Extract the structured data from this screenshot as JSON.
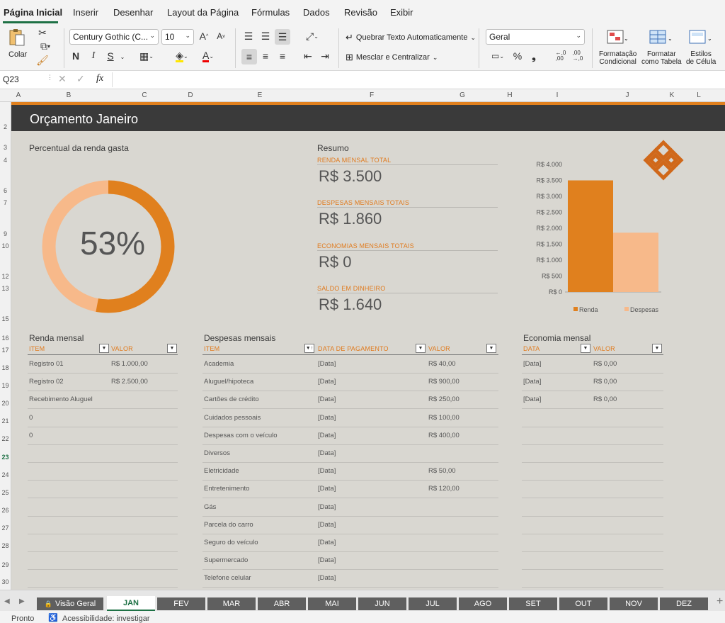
{
  "ribbon_tabs": [
    "Página Inicial",
    "Inserir",
    "Desenhar",
    "Layout da Página",
    "Fórmulas",
    "Dados",
    "Revisão",
    "Exibir"
  ],
  "ribbon": {
    "paste_label": "Colar",
    "font_name": "Century Gothic (C...",
    "font_size": "10",
    "bold": "N",
    "italic": "I",
    "underline": "S",
    "wrap_text": "Quebrar Texto Automaticamente",
    "merge_center": "Mesclar e Centralizar",
    "number_format": "Geral",
    "percent": "%",
    "comma": "❟",
    "dec_inc": "←,0\n,00",
    "dec_dec": ",00\n→,0",
    "cond_format": [
      "Formatação",
      "Condicional"
    ],
    "format_table": [
      "Formatar",
      "como Tabela"
    ],
    "cell_styles": [
      "Estilos",
      "de Célula"
    ]
  },
  "formula_bar": {
    "name_box": "Q23",
    "fx": "fx",
    "value": ""
  },
  "columns": [
    [
      "A",
      26
    ],
    [
      "B",
      97
    ],
    [
      "C",
      204
    ],
    [
      "D",
      269
    ],
    [
      "E",
      367
    ],
    [
      "F",
      525
    ],
    [
      "G",
      653
    ],
    [
      "H",
      720
    ],
    [
      "I",
      787
    ],
    [
      "J",
      886
    ],
    [
      "K",
      949
    ],
    [
      "L",
      987
    ]
  ],
  "rows": [
    [
      "2",
      179
    ],
    [
      "3",
      208
    ],
    [
      "4",
      226
    ],
    [
      "6",
      269
    ],
    [
      "7",
      286
    ],
    [
      "9",
      330
    ],
    [
      "10",
      347
    ],
    [
      "12",
      390
    ],
    [
      "13",
      407
    ],
    [
      "15",
      450
    ],
    [
      "16",
      477
    ],
    [
      "17",
      494
    ],
    [
      "18",
      519
    ],
    [
      "19",
      544
    ],
    [
      "20",
      569
    ],
    [
      "21",
      594
    ],
    [
      "22",
      619
    ],
    [
      "23",
      645
    ],
    [
      "24",
      670
    ],
    [
      "25",
      695
    ],
    [
      "26",
      720
    ],
    [
      "27",
      745
    ],
    [
      "28",
      770
    ],
    [
      "29",
      797
    ],
    [
      "30",
      821
    ]
  ],
  "selected_row": "23",
  "sheet": {
    "title": "Orçamento Janeiro",
    "pct_label": "Percentual da renda gasta",
    "pct_value": "53%",
    "pct_fraction": 0.53,
    "colors": {
      "accent": "#e0801e",
      "light": "#f7b98a",
      "dark": "#3a3a3a"
    },
    "summary": {
      "label": "Resumo",
      "items": [
        {
          "label": "RENDA MENSAL TOTAL",
          "value": "R$ 3.500"
        },
        {
          "label": "DESPESAS MENSAIS TOTAIS",
          "value": "R$ 1.860"
        },
        {
          "label": "ECONOMIAS MENSAIS TOTAIS",
          "value": "R$ 0"
        },
        {
          "label": "SALDO EM DINHEIRO",
          "value": "R$ 1.640"
        }
      ]
    },
    "income": {
      "label": "Renda mensal",
      "headers": [
        "ITEM",
        "VALOR"
      ],
      "rows": [
        [
          "Registro 01",
          "R$ 1.000,00"
        ],
        [
          "Registro 02",
          "R$ 2.500,00"
        ],
        [
          "Recebimento Aluguel",
          ""
        ],
        [
          "0",
          ""
        ],
        [
          "0",
          ""
        ]
      ]
    },
    "expenses": {
      "label": "Despesas mensais",
      "headers": [
        "ITEM",
        "DATA DE PAGAMENTO",
        "VALOR"
      ],
      "rows": [
        [
          "Academia",
          "[Data]",
          "R$ 40,00"
        ],
        [
          "Aluguel/hipoteca",
          "[Data]",
          "R$ 900,00"
        ],
        [
          "Cartões de crédito",
          "[Data]",
          "R$ 250,00"
        ],
        [
          "Cuidados pessoais",
          "[Data]",
          "R$ 100,00"
        ],
        [
          "Despesas com o veículo",
          "[Data]",
          "R$ 400,00"
        ],
        [
          "Diversos",
          "[Data]",
          ""
        ],
        [
          "Eletricidade",
          "[Data]",
          "R$ 50,00"
        ],
        [
          "Entretenimento",
          "[Data]",
          "R$ 120,00"
        ],
        [
          "Gás",
          "[Data]",
          ""
        ],
        [
          "Parcela do carro",
          "[Data]",
          ""
        ],
        [
          "Seguro do veículo",
          "[Data]",
          ""
        ],
        [
          "Supermercado",
          "[Data]",
          ""
        ],
        [
          "Telefone celular",
          "[Data]",
          ""
        ]
      ]
    },
    "savings": {
      "label": "Economia mensal",
      "headers": [
        "DATA",
        "VALOR"
      ],
      "rows": [
        [
          "[Data]",
          "R$ 0,00"
        ],
        [
          "[Data]",
          "R$ 0,00"
        ],
        [
          "[Data]",
          "R$ 0,00"
        ]
      ]
    }
  },
  "chart_data": {
    "type": "bar",
    "categories": [
      "Renda",
      "Despesas"
    ],
    "values": [
      3500,
      1860
    ],
    "ylim": [
      0,
      4000
    ],
    "yticks": [
      "R$ 0",
      "R$ 500",
      "R$ 1.000",
      "R$ 1.500",
      "R$ 2.000",
      "R$ 2.500",
      "R$ 3.000",
      "R$ 3.500",
      "R$ 4.000"
    ],
    "colors": [
      "#e0801e",
      "#f7b98a"
    ],
    "legend": [
      "Renda",
      "Despesas"
    ],
    "legend_position": "bottom"
  },
  "sheet_tabs": [
    "Visão Geral",
    "JAN",
    "FEV",
    "MAR",
    "ABR",
    "MAI",
    "JUN",
    "JUL",
    "AGO",
    "SET",
    "OUT",
    "NOV",
    "DEZ"
  ],
  "active_sheet": "JAN",
  "status": {
    "ready": "Pronto",
    "accessibility": "Acessibilidade: investigar"
  }
}
